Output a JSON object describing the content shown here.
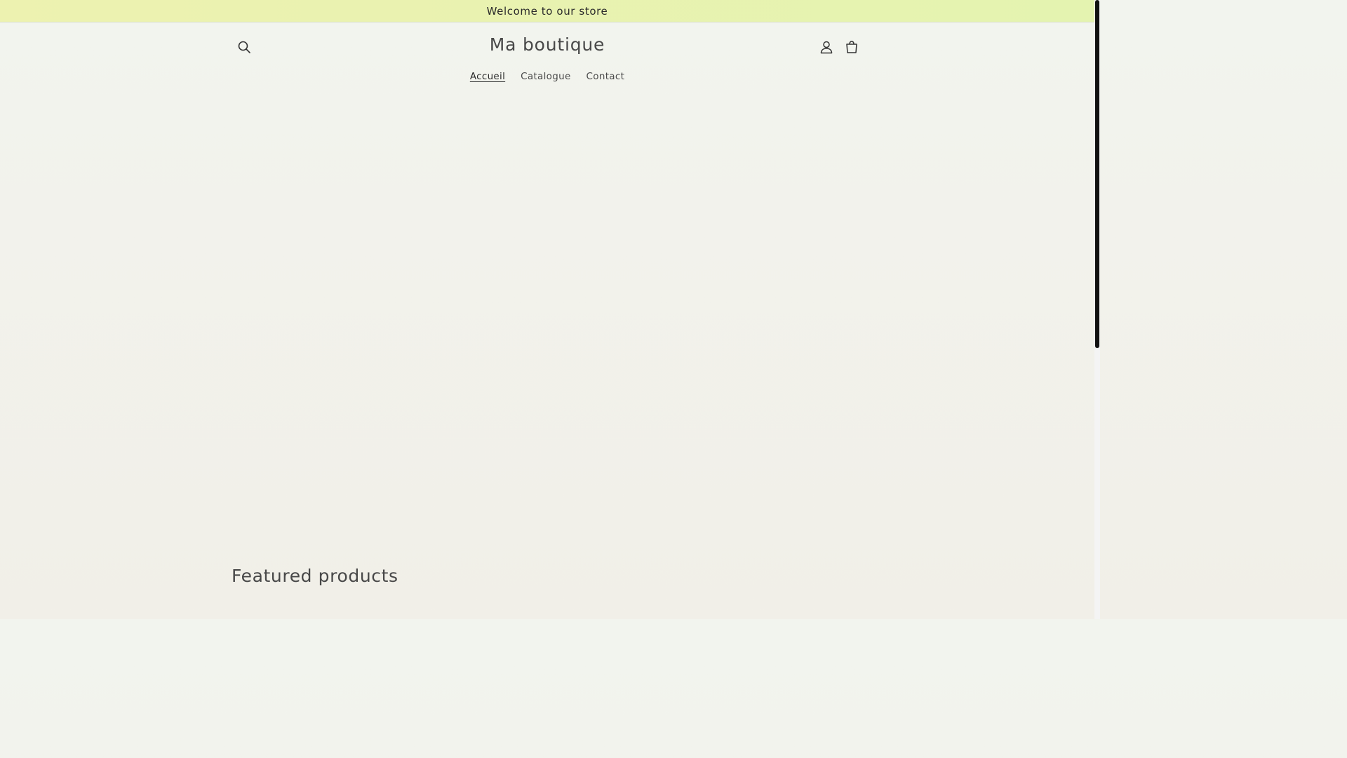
{
  "announcement": {
    "text": "Welcome to our store"
  },
  "header": {
    "brand": "Ma boutique",
    "icons": {
      "search": "search-icon",
      "account": "account-icon",
      "cart": "cart-icon"
    }
  },
  "nav": {
    "items": [
      {
        "label": "Accueil",
        "active": true
      },
      {
        "label": "Catalogue",
        "active": false
      },
      {
        "label": "Contact",
        "active": false
      }
    ]
  },
  "featured": {
    "title": "Featured products"
  },
  "colors": {
    "announcement_bg": "#e9f3b0",
    "page_bg": "#f1f2ec",
    "text": "#484848"
  }
}
